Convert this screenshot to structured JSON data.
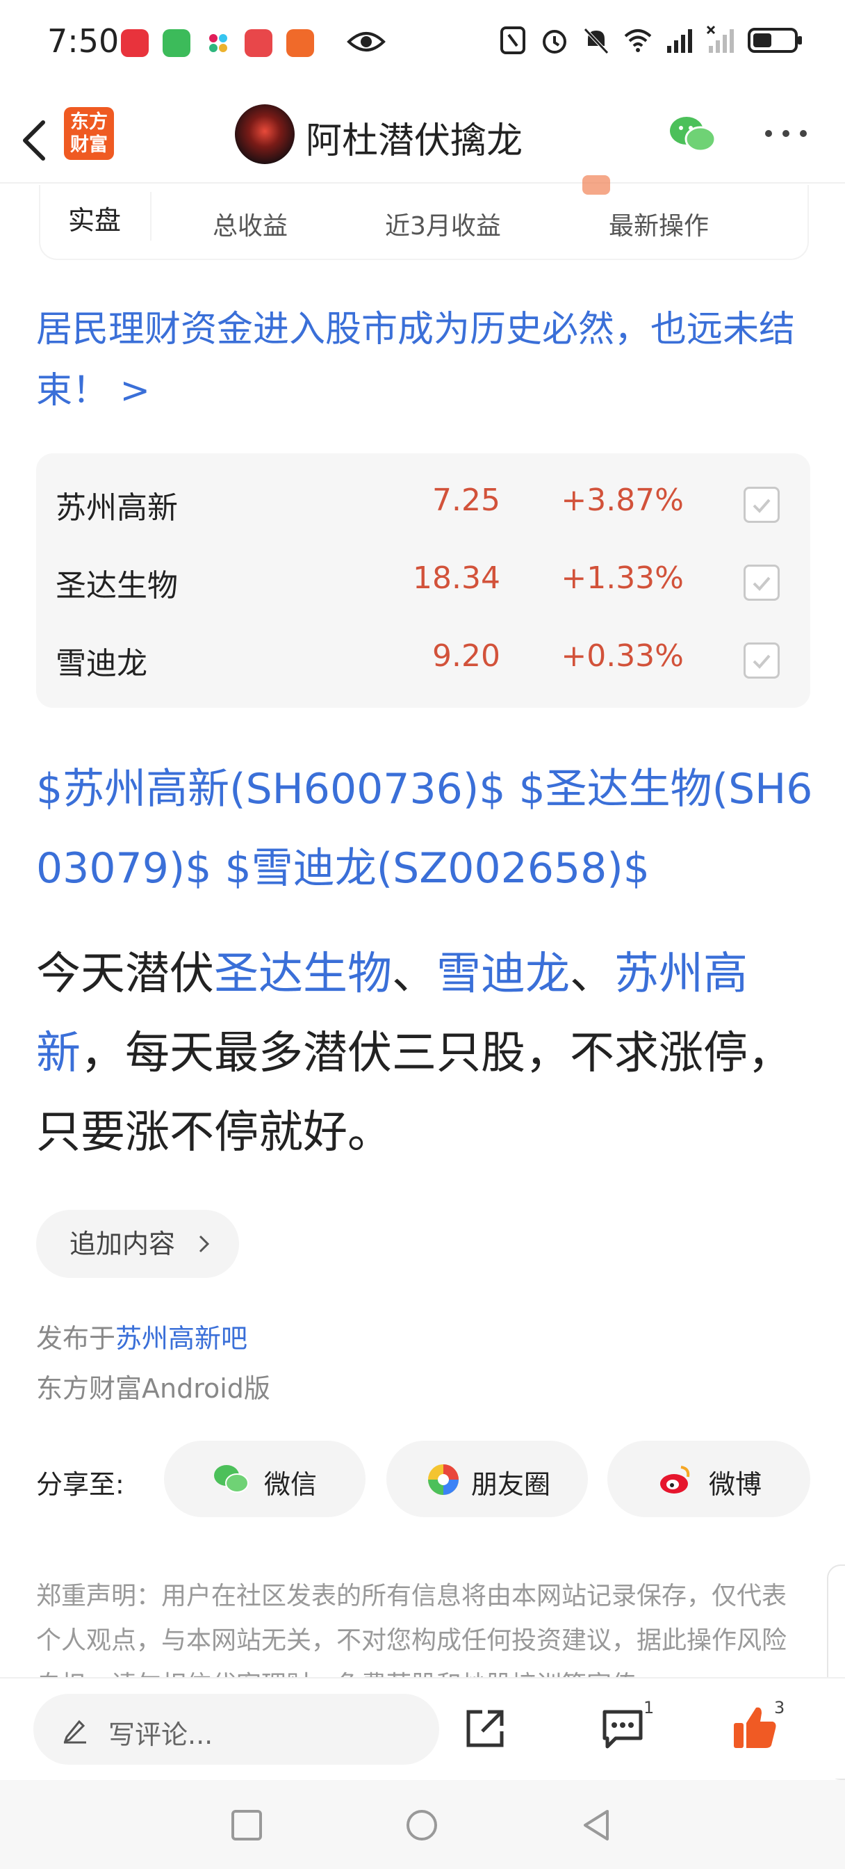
{
  "status_bar": {
    "time": "7:50",
    "app_icons": [
      "xiaohongshu-icon",
      "wechat-icon",
      "slack-icon",
      "notes-icon",
      "feishu-icon"
    ],
    "right_icons": [
      "eye-icon",
      "nfc-icon",
      "alarm-icon",
      "mute-icon",
      "wifi-icon",
      "signal-icon",
      "no-signal-icon",
      "battery-icon"
    ]
  },
  "nav": {
    "logo_line1": "东方",
    "logo_line2": "财富",
    "title": "阿杜潜伏擒龙"
  },
  "stats": {
    "tab": "实盘",
    "labels": [
      "总收益",
      "近3月收益",
      "最新操作"
    ]
  },
  "post": {
    "title": "居民理财资金进入股市成为历史必然，也远未结束！ >"
  },
  "stocks": [
    {
      "name": "苏州高新",
      "price": "7.25",
      "change": "+3.87%"
    },
    {
      "name": "圣达生物",
      "price": "18.34",
      "change": "+1.33%"
    },
    {
      "name": "雪迪龙",
      "price": "9.20",
      "change": "+0.33%"
    }
  ],
  "tags": "$苏州高新(SH600736)$  $圣达生物(SH603079)$  $雪迪龙(SZ002658)$",
  "body": {
    "p1": "今天潜伏",
    "l1": "圣达生物",
    "s1": "、",
    "l2": "雪迪龙",
    "s2": "、",
    "l3": "苏州高新",
    "p2": "，每天最多潜伏三只股，不求涨停，只要涨不停就好。"
  },
  "append": {
    "label": "追加内容"
  },
  "published": {
    "prefix": "发布于",
    "board": "苏州高新吧"
  },
  "client": "东方财富Android版",
  "share": {
    "label": "分享至:",
    "wechat": "微信",
    "moments": "朋友圈",
    "weibo": "微博"
  },
  "disclaimer": "郑重声明：用户在社区发表的所有信息将由本网站记录保存，仅代表个人观点，与本网站无关，不对您构成任何投资建议，据此操作风险自担。请勿相信代客理财、免费荐股和炒股培训等宣传",
  "bottom": {
    "comment_placeholder": "写评论...",
    "comment_count": "1",
    "like_count": "3"
  },
  "colors": {
    "link": "#3a6fd8",
    "up": "#d2523a",
    "brand": "#ef5a22",
    "like": "#f05a24"
  }
}
